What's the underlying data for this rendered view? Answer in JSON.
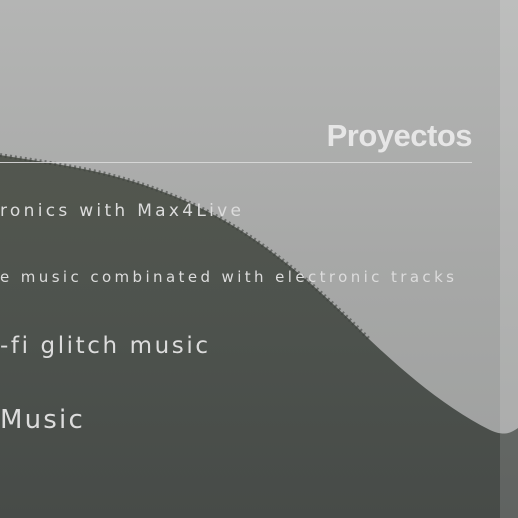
{
  "section": {
    "title": "Proyectos"
  },
  "projects": [
    {
      "label": "ronics with Max4Live"
    },
    {
      "label": "e music combinated with electronic tracks"
    },
    {
      "label": "-fi glitch music"
    },
    {
      "label": "Music"
    }
  ]
}
